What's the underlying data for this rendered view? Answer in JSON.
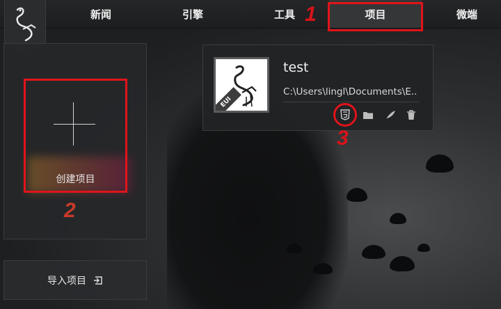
{
  "nav": {
    "items": [
      {
        "label": "新闻"
      },
      {
        "label": "引擎"
      },
      {
        "label": "工具"
      },
      {
        "label": "项目"
      },
      {
        "label": "微端"
      }
    ],
    "active": "项目"
  },
  "left_panel": {
    "create_label": "创建项目",
    "import_label": "导入项目"
  },
  "project": {
    "name": "test",
    "path": "C:\\Users\\lingl\\Documents\\E..",
    "badge": "EUI",
    "actions": [
      "html5-icon",
      "folder-icon",
      "feather-icon",
      "trash-icon"
    ]
  },
  "annotations": {
    "step1": "1",
    "step2": "2",
    "step3": "3"
  },
  "colors": {
    "highlight": "#e0141a",
    "topbar": "#1f2022",
    "panel": "#262729"
  }
}
